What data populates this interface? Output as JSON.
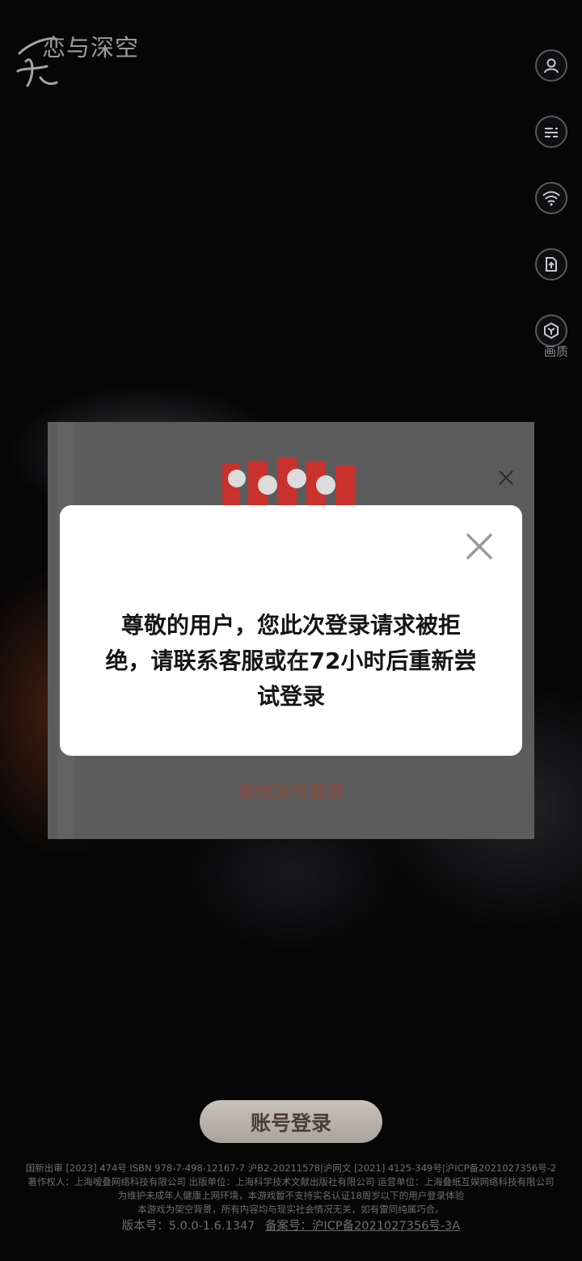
{
  "app": {
    "logo_text": "恋与深空"
  },
  "side": {
    "quality_label": "画质"
  },
  "login_panel": {
    "other_login_label": "其他账号登录"
  },
  "dialog": {
    "message": "尊敬的用户，您此次登录请求被拒绝，请联系客服或在72小时后重新尝试登录"
  },
  "account_login_label": "账号登录",
  "footer": {
    "line1": "国新出审 [2023] 474号  ISBN 978-7-498-12167-7  沪B2-20211578|沪网文 [2021] 4125-349号|沪ICP备2021027356号-2",
    "line2": "著作权人：上海嗳叠网络科技有限公司  出版单位：上海科学技术文献出版社有限公司  运营单位：上海叠纸互娱网络科技有限公司",
    "line3": "为维护未成年人健康上网环境，本游戏暂不支持实名认证18周岁以下的用户登录体验",
    "line4": "本游戏为架空背景，所有内容均与现实社会情况无关，如有雷同纯属巧合。",
    "version": "版本号：5.0.0-1.6.1347",
    "beian": "备案号：沪ICP备2021027356号-3A"
  },
  "colors": {
    "accent": "#8c4a36",
    "panel": "#5c5c5d",
    "dialog": "#ffffff"
  },
  "icons": [
    "user-icon",
    "notice-icon",
    "wifi-icon",
    "export-icon",
    "quality-icon",
    "close-icon",
    "brand-logo"
  ]
}
